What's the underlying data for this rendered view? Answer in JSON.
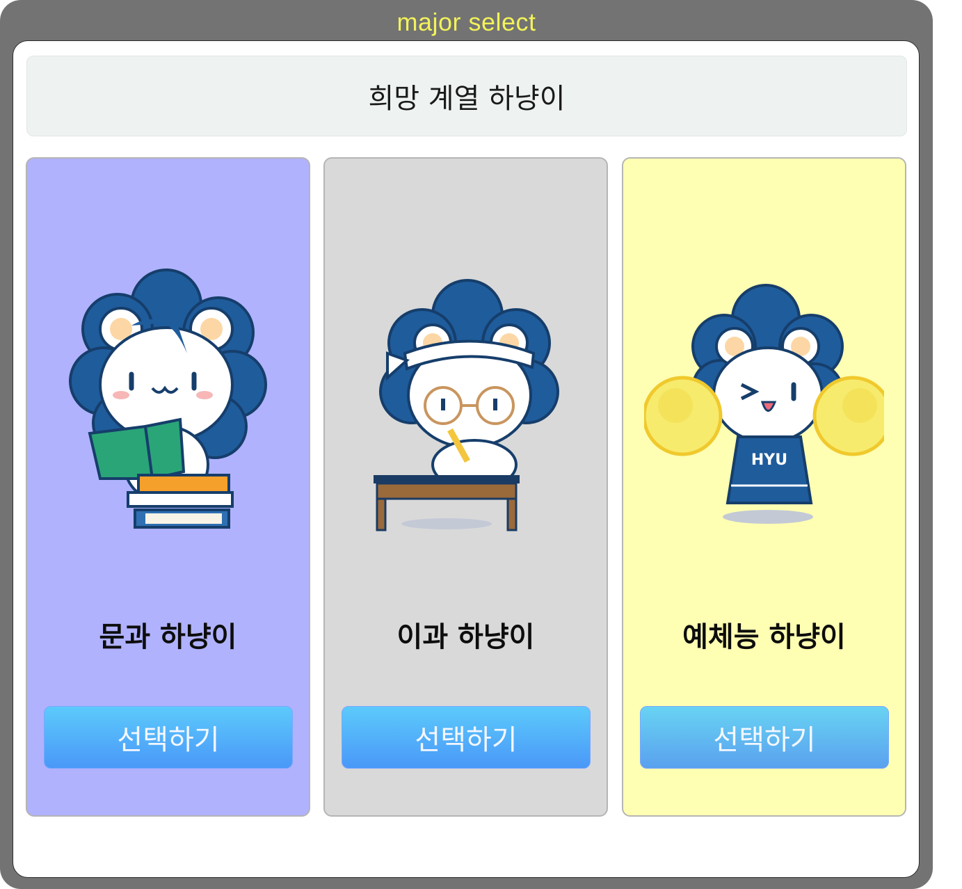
{
  "window": {
    "title": "major select"
  },
  "header": {
    "title": "희망 계열 하냥이"
  },
  "cards": [
    {
      "label": "문과 하냥이",
      "button": "선택하기",
      "mascot": "mascot-reading-book",
      "background": "#b0b2fd"
    },
    {
      "label": "이과 하냥이",
      "button": "선택하기",
      "mascot": "mascot-studying-at-desk",
      "background": "#d9d9d9"
    },
    {
      "label": "예체능 하냥이",
      "button": "선택하기",
      "mascot": "mascot-cheerleader-pompoms",
      "background": "#feffb2"
    }
  ],
  "mascot_text": {
    "jersey": "HYU"
  },
  "colors": {
    "accent_button_top": "#5ccafb",
    "accent_button_bottom": "#4a98f8",
    "mascot_hair": "#1f5c9c"
  }
}
